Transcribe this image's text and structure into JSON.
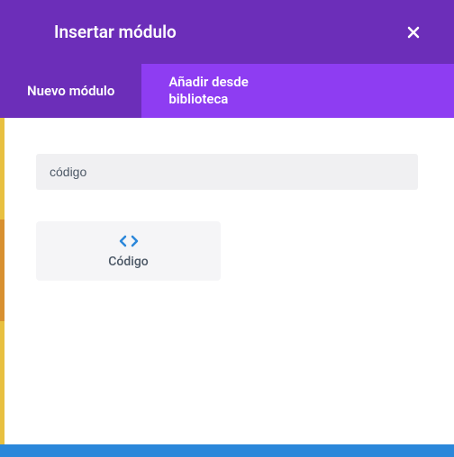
{
  "modal": {
    "title": "Insertar módulo"
  },
  "tabs": {
    "new_module": "Nuevo módulo",
    "from_library": "Añadir desde\nbiblioteca"
  },
  "search": {
    "value": "código"
  },
  "modules": {
    "code": {
      "label": "Código"
    }
  }
}
